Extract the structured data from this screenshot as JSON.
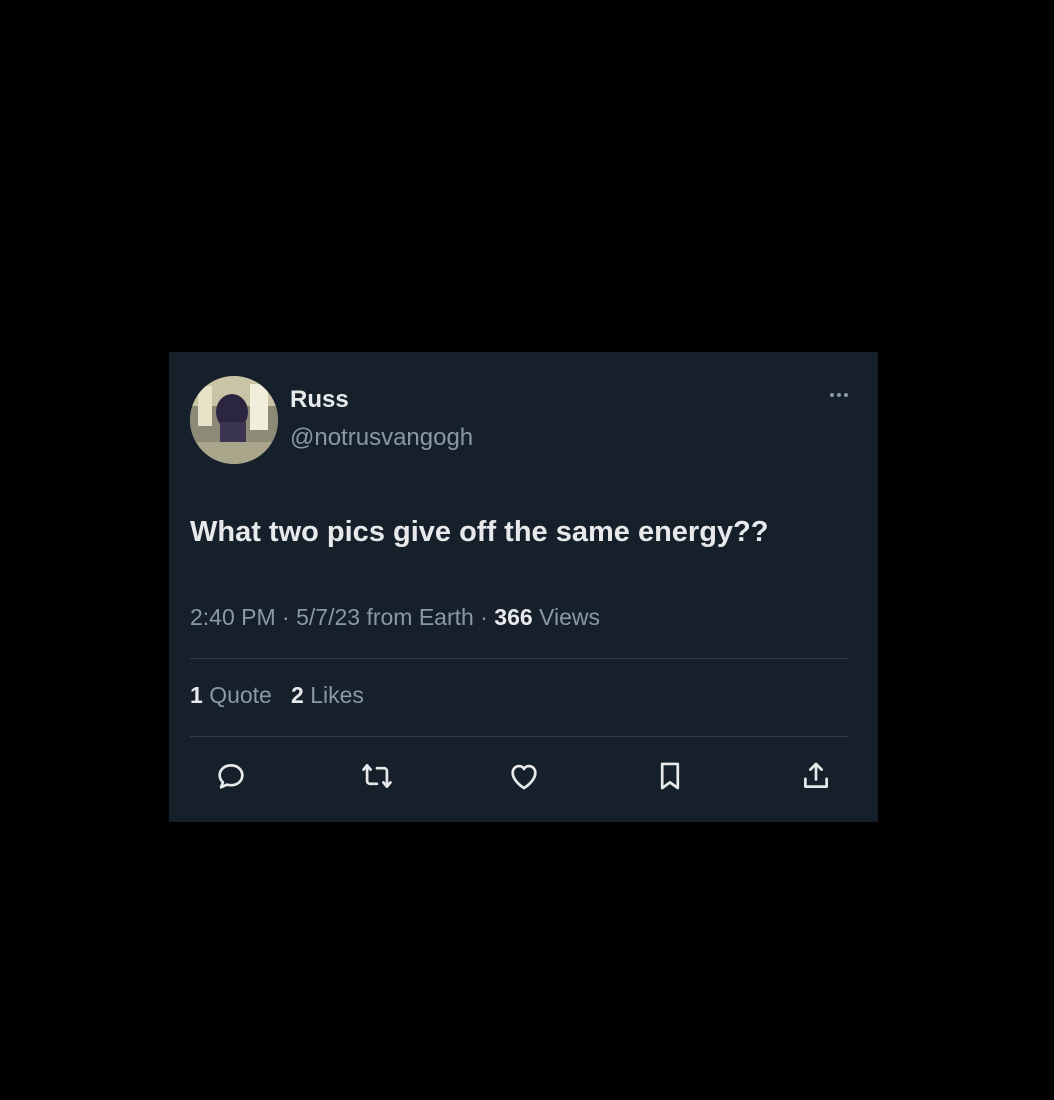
{
  "tweet": {
    "display_name": "Russ",
    "handle": "@notrusvangogh",
    "text": "What two pics give off the same energy??",
    "time": "2:40 PM",
    "date": "5/7/23",
    "source": "from Earth",
    "views_count": "366",
    "views_label": "Views",
    "quotes_count": "1",
    "quotes_label": "Quote",
    "likes_count": "2",
    "likes_label": "Likes"
  },
  "actions": {
    "icons": [
      "reply-icon",
      "retweet-icon",
      "like-icon",
      "bookmark-icon",
      "share-icon"
    ]
  },
  "colors": {
    "page_background": "#000000",
    "card_background": "#15202b",
    "primary_text": "#e7e9ea",
    "secondary_text": "#8b98a5"
  }
}
